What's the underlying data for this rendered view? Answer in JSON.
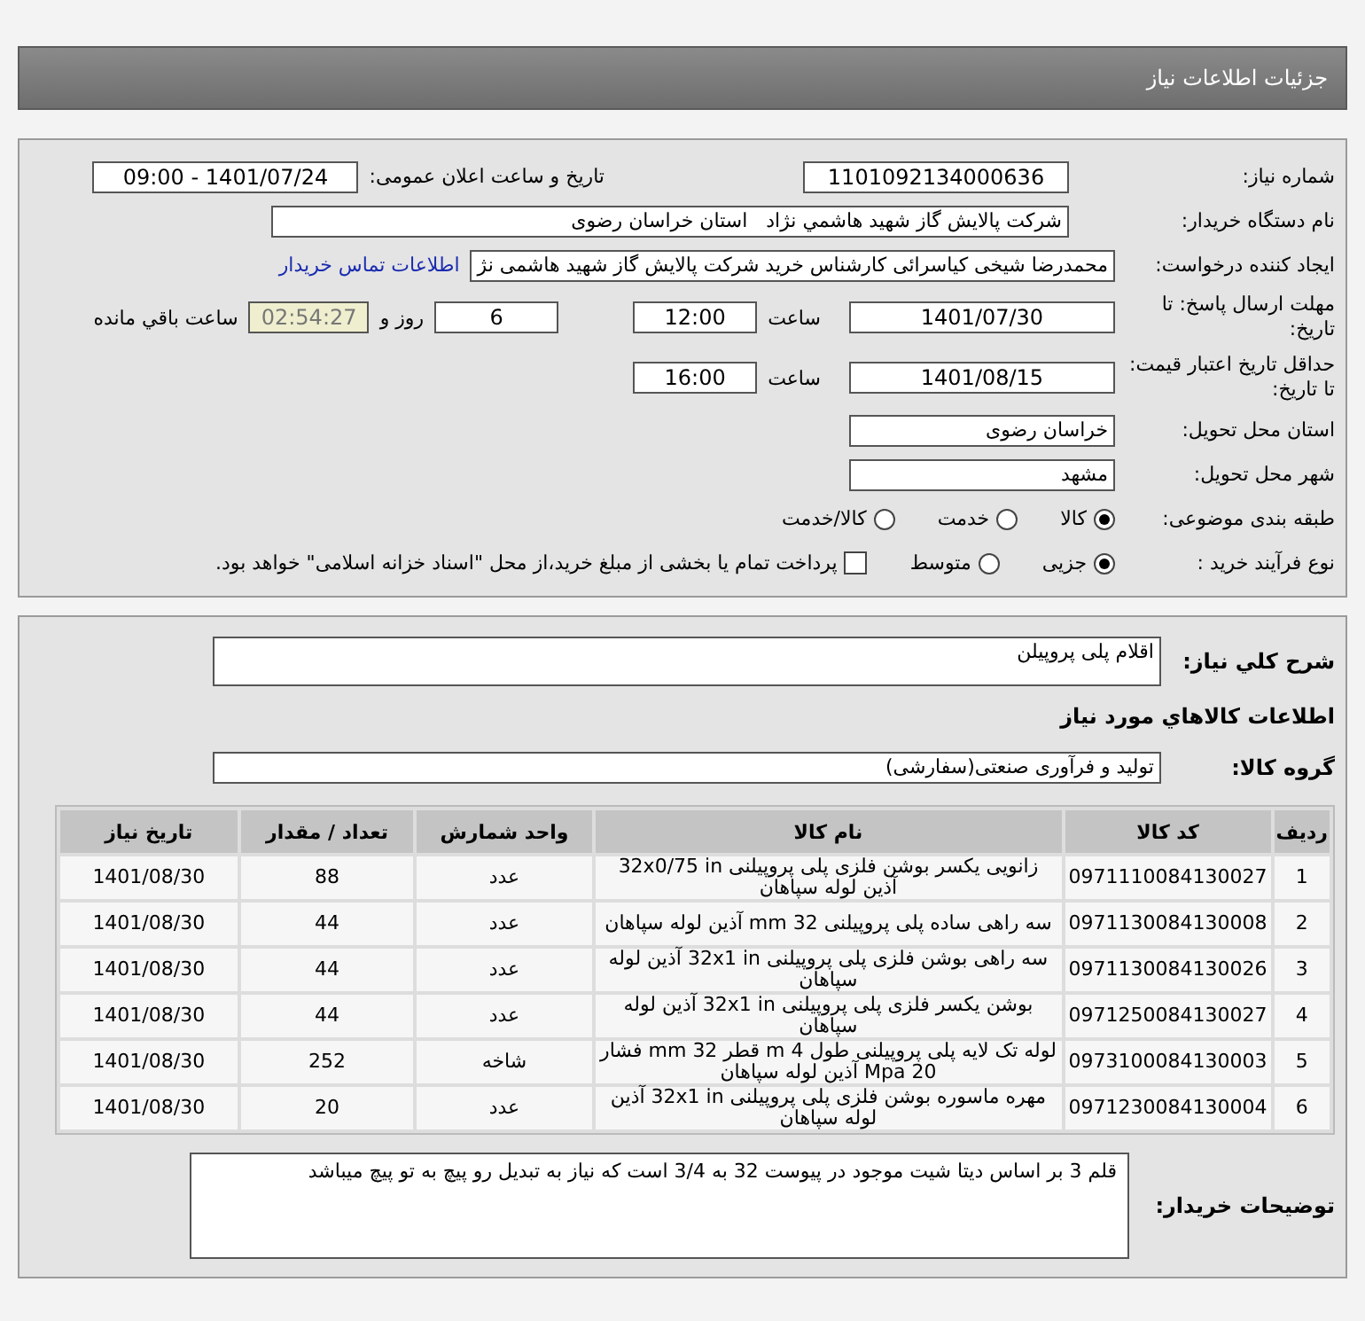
{
  "header": {
    "title": "جزئیات اطلاعات نیاز"
  },
  "need_number": {
    "label": "شماره نیاز:",
    "value": "1101092134000636"
  },
  "announce": {
    "label": "تاریخ و ساعت اعلان عمومی:",
    "value": "1401/07/24 - 09:00"
  },
  "buyer": {
    "label": "نام دستگاه خریدار:",
    "value": "شرکت پالایش گاز شهید هاشمي نژاد   استان خراسان رضوی"
  },
  "requester": {
    "label": "ایجاد کننده درخواست:",
    "value": "محمدرضا شیخی کیاسرائی کارشناس خرید شرکت پالایش گاز شهید هاشمی نژ",
    "link": "اطلاعات تماس خریدار"
  },
  "deadline": {
    "label": "مهلت ارسال پاسخ: تا تاریخ:",
    "date": "1401/07/30",
    "time_label": "ساعت",
    "time": "12:00",
    "days": "6",
    "days_label": "روز و",
    "remaining": "02:54:27",
    "remaining_label": "ساعت باقي مانده"
  },
  "validity": {
    "label": "حداقل تاریخ اعتبار قیمت: تا تاریخ:",
    "date": "1401/08/15",
    "time_label": "ساعت",
    "time": "16:00"
  },
  "province": {
    "label": "استان محل تحویل:",
    "value": "خراسان رضوی"
  },
  "city": {
    "label": "شهر محل تحویل:",
    "value": "مشهد"
  },
  "category": {
    "label": "طبقه بندی موضوعی:",
    "options": [
      {
        "label": "کالا",
        "selected": true
      },
      {
        "label": "خدمت",
        "selected": false
      },
      {
        "label": "کالا/خدمت",
        "selected": false
      }
    ]
  },
  "process": {
    "label": "نوع فرآیند خرید :",
    "options": [
      {
        "label": "جزیی",
        "selected": true
      },
      {
        "label": "متوسط",
        "selected": false
      }
    ],
    "treasury": {
      "label": "پرداخت تمام یا بخشی از مبلغ خرید،از محل \"اسناد خزانه اسلامی\" خواهد بود.",
      "checked": false
    }
  },
  "description": {
    "label": "شرح کلي نياز:",
    "value": "اقلام پلی پروپیلن"
  },
  "goods_title": "اطلاعات کالاهاي مورد نياز",
  "goods_group": {
    "label": "گروه کالا:",
    "value": "تولید و فرآوری صنعتی(سفارشی)"
  },
  "table": {
    "columns": [
      "رديف",
      "کد کالا",
      "نام کالا",
      "واحد شمارش",
      "تعداد / مقدار",
      "تاریخ نیاز"
    ],
    "rows": [
      [
        "1",
        "0971110084130027",
        "زانویی یکسر بوشن فلزی پلی پروپیلنی 32x0/75 in آذین لوله سپاهان",
        "عدد",
        "88",
        "1401/08/30"
      ],
      [
        "2",
        "0971130084130008",
        "سه راهی ساده پلی پروپیلنی 32 mm آذین لوله سپاهان",
        "عدد",
        "44",
        "1401/08/30"
      ],
      [
        "3",
        "0971130084130026",
        "سه راهی بوشن فلزی پلی پروپیلنی 32x1 in آذین لوله سپاهان",
        "عدد",
        "44",
        "1401/08/30"
      ],
      [
        "4",
        "0971250084130027",
        "بوشن یکسر فلزی پلی پروپیلنی 32x1 in آذین لوله سپاهان",
        "عدد",
        "44",
        "1401/08/30"
      ],
      [
        "5",
        "0973100084130003",
        "لوله تک لایه پلی پروپیلنی طول 4 m قطر 32 mm فشار 20 Mpa آذین لوله سپاهان",
        "شاخه",
        "252",
        "1401/08/30"
      ],
      [
        "6",
        "0971230084130004",
        "مهره ماسوره بوشن فلزی پلی پروپیلنی 32x1 in آذین لوله سپاهان",
        "عدد",
        "20",
        "1401/08/30"
      ]
    ]
  },
  "buyer_notes": {
    "label": "توضیحات خریدار:",
    "value": "قلم 3 بر اساس دیتا شیت موجود در پیوست 32 به 3/4 است که نیاز به تبدیل رو پیچ به تو پیچ میباشد"
  }
}
